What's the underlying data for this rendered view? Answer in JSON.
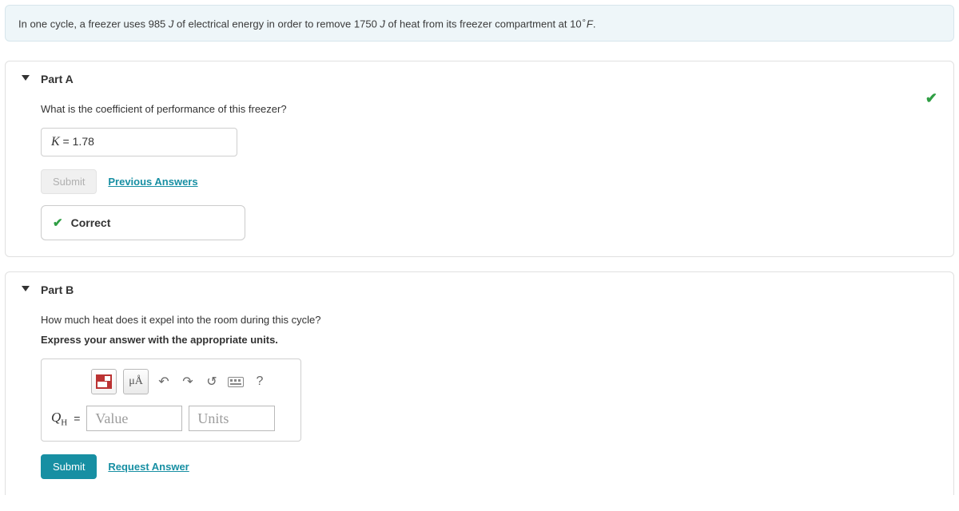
{
  "problem": {
    "prefix": "In one cycle, a freezer uses ",
    "energy_val": "985",
    "energy_unit": "J",
    "mid1": " of electrical energy in order to remove ",
    "heat_val": "1750",
    "heat_unit": "J",
    "mid2": " of heat from its freezer compartment at ",
    "temp_val": "10",
    "temp_deg": "∘",
    "temp_unit": "F",
    "suffix": "."
  },
  "partA": {
    "title": "Part A",
    "question": "What is the coefficient of performance of this freezer?",
    "answer_var": "K",
    "answer_eq": " = ",
    "answer_val": "1.78",
    "submit_label": "Submit",
    "prev_answers_label": "Previous Answers",
    "feedback": "Correct"
  },
  "partB": {
    "title": "Part B",
    "question": "How much heat does it expel into the room during this cycle?",
    "instruction": "Express your answer with the appropriate units.",
    "toolbar": {
      "units_btn": "μÅ",
      "help_btn": "?"
    },
    "var_label_main": "Q",
    "var_label_sub": "H",
    "var_label_eq": " = ",
    "value_placeholder": "Value",
    "units_placeholder": "Units",
    "submit_label": "Submit",
    "request_answer_label": "Request Answer"
  }
}
